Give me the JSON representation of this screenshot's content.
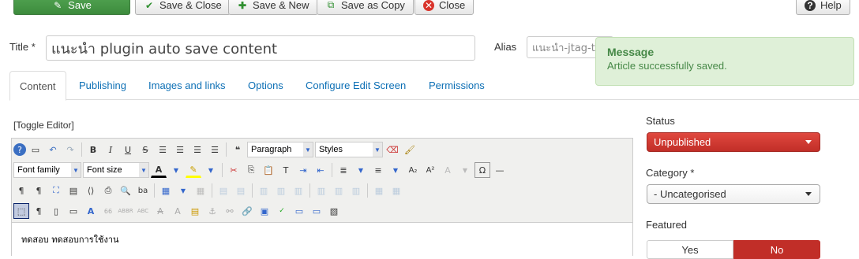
{
  "toolbar": {
    "save": "Save",
    "save_close": "Save & Close",
    "save_new": "Save & New",
    "save_copy": "Save as Copy",
    "close": "Close",
    "help": "Help"
  },
  "form": {
    "title_label": "Title *",
    "title_value": "แนะนำ plugin auto save content",
    "alias_label": "Alias",
    "alias_value": "แนะนำ-jtag-ta"
  },
  "message": {
    "heading": "Message",
    "text": "Article successfully saved."
  },
  "tabs": [
    "Content",
    "Publishing",
    "Images and links",
    "Options",
    "Configure Edit Screen",
    "Permissions"
  ],
  "editor": {
    "toggle_label": "[Toggle Editor]",
    "format_select": "Paragraph",
    "styles_select": "Styles",
    "font_family": "Font family",
    "font_size": "Font size",
    "content_text": "ทดสอบ ทดสอบการใช้งาน"
  },
  "sidebar": {
    "status_label": "Status",
    "status_value": "Unpublished",
    "category_label": "Category *",
    "category_value": "- Uncategorised",
    "featured_label": "Featured",
    "featured_yes": "Yes",
    "featured_no": "No"
  },
  "colors": {
    "save_green": "#46a546",
    "status_red": "#c12e28",
    "link_blue": "#0c6fb5",
    "message_bg": "#dff0d8"
  }
}
